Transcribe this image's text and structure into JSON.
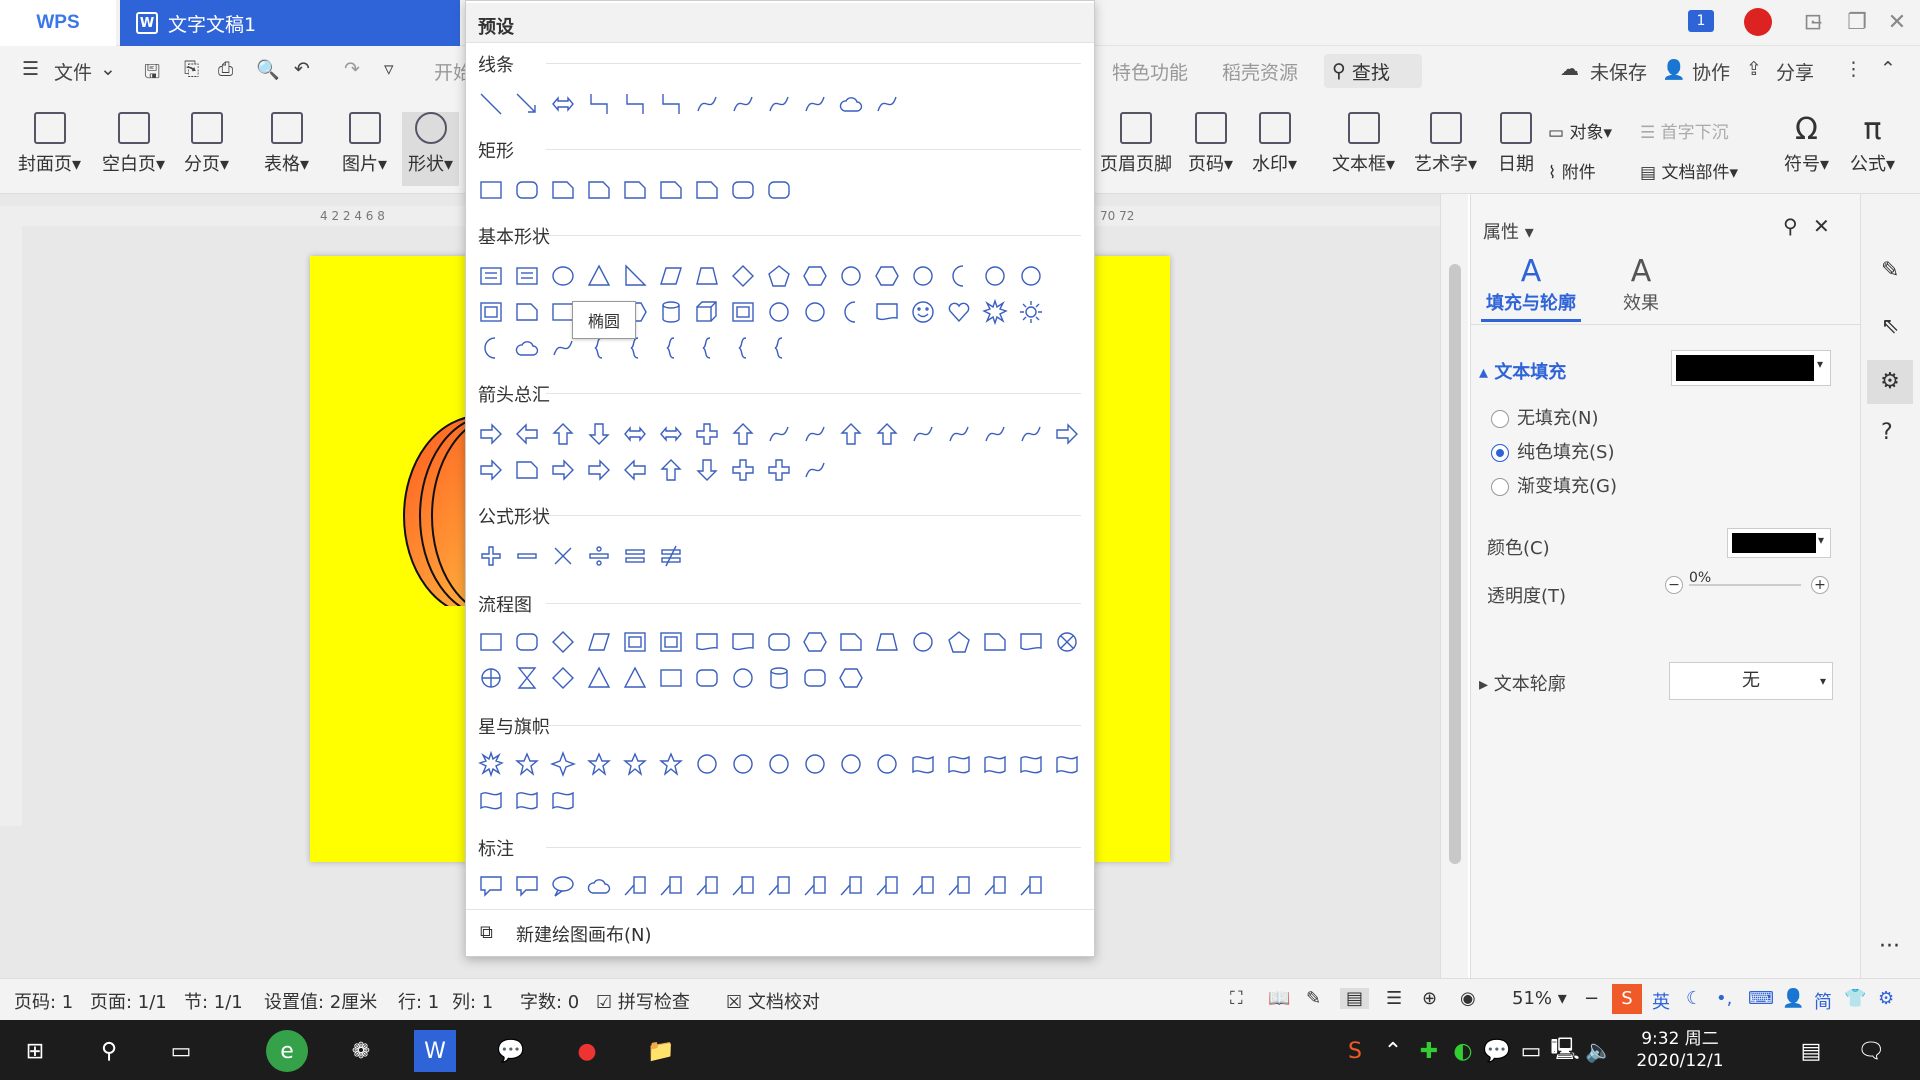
{
  "titlebar": {
    "app": "WPS",
    "doc_tab": "文字文稿1",
    "tab_icon": "W",
    "badge": "1"
  },
  "menu": {
    "file": "文件",
    "start": "开始",
    "special": "特色功能",
    "resource": "稻壳资源",
    "search": "查找",
    "unsaved": "未保存",
    "collab": "协作",
    "share": "分享"
  },
  "ribbon": {
    "cover": "封面页",
    "blank": "空白页",
    "pagebreak": "分页",
    "table": "表格",
    "picture": "图片",
    "shape": "形状",
    "header_footer": "页眉页脚",
    "page_no": "页码",
    "watermark": "水印",
    "textbox": "文本框",
    "wordart": "艺术字",
    "date": "日期",
    "object": "对象",
    "attachment": "附件",
    "dropcap": "首字下沉",
    "docpart": "文档部件",
    "symbol": "符号",
    "formula": "公式"
  },
  "ruler": {
    "left_ticks": "4 2 2 4 6 8",
    "right_ticks": "70 72"
  },
  "panel": {
    "title": "预设",
    "sections": {
      "lines": "线条",
      "rect": "矩形",
      "basic": "基本形状",
      "arrows": "箭头总汇",
      "formula": "公式形状",
      "flow": "流程图",
      "stars": "星与旗帜",
      "callout": "标注"
    },
    "tooltip": "椭圆",
    "new_canvas": "新建绘图画布(N)"
  },
  "props": {
    "title": "属性",
    "tab_fill": "填充与轮廓",
    "tab_effect": "效果",
    "text_fill": "文本填充",
    "no_fill": "无填充(N)",
    "solid_fill": "纯色填充(S)",
    "gradient_fill": "渐变填充(G)",
    "color": "颜色(C)",
    "transparency": "透明度(T)",
    "transparency_value": "0%",
    "outline": "文本轮廓",
    "outline_value": "无",
    "fill_color": "#000000",
    "solid_selected": true
  },
  "status": {
    "page": "页码: 1",
    "pages": "页面: 1/1",
    "section": "节: 1/1",
    "setting": "设置值: 2厘米",
    "row": "行: 1",
    "col": "列: 1",
    "words": "字数: 0",
    "spell": "拼写检查",
    "proof": "文档校对",
    "zoom": "51%"
  },
  "taskbar": {
    "time": "9:32 周二",
    "date": "2020/12/1",
    "ime": "英",
    "ime2": "简"
  },
  "colors": {
    "accent": "#2f64d8",
    "page": "#ffff00",
    "shape_line": "#3a5fbf"
  }
}
